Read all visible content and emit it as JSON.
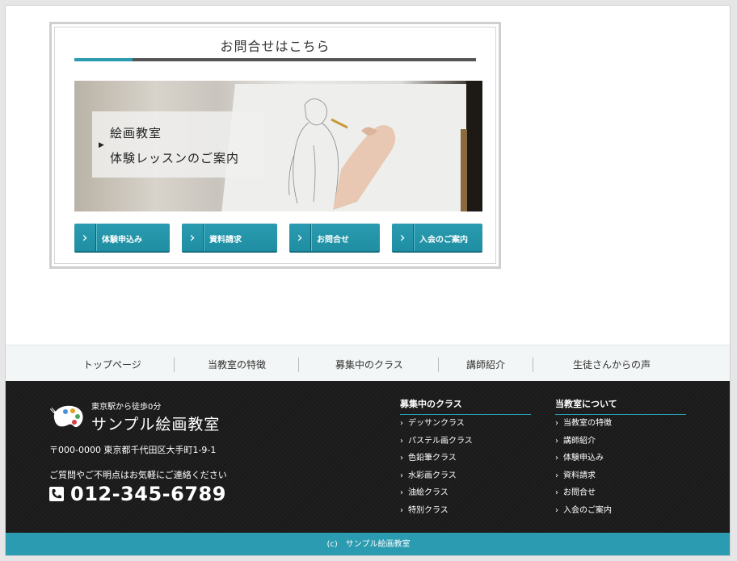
{
  "contact": {
    "title": "お問合せはこちら",
    "hero_line1": "絵画教室",
    "hero_line2": "体験レッスンのご案内",
    "buttons": [
      "体験申込み",
      "資料請求",
      "お問合せ",
      "入会のご案内"
    ]
  },
  "nav": [
    "トップページ",
    "当教室の特徴",
    "募集中のクラス",
    "講師紹介",
    "生徒さんからの声"
  ],
  "footer": {
    "tagline": "東京駅から徒歩0分",
    "site_name": "サンプル絵画教室",
    "address": "〒000-0000 東京都千代田区大手町1-9-1",
    "inquiry": "ご質問やご不明点はお気軽にご連絡ください",
    "phone": "012-345-6789",
    "col1": {
      "title": "募集中のクラス",
      "items": [
        "デッサンクラス",
        "パステル画クラス",
        "色鉛筆クラス",
        "水彩画クラス",
        "油絵クラス",
        "特別クラス"
      ]
    },
    "col2": {
      "title": "当教室について",
      "items": [
        "当教室の特徴",
        "講師紹介",
        "体験申込み",
        "資料請求",
        "お問合せ",
        "入会のご案内"
      ]
    }
  },
  "copyright": "(c)　サンプル絵画教室",
  "colors": {
    "accent": "#2a9bb0",
    "footer_bg": "#1b1b1b"
  }
}
